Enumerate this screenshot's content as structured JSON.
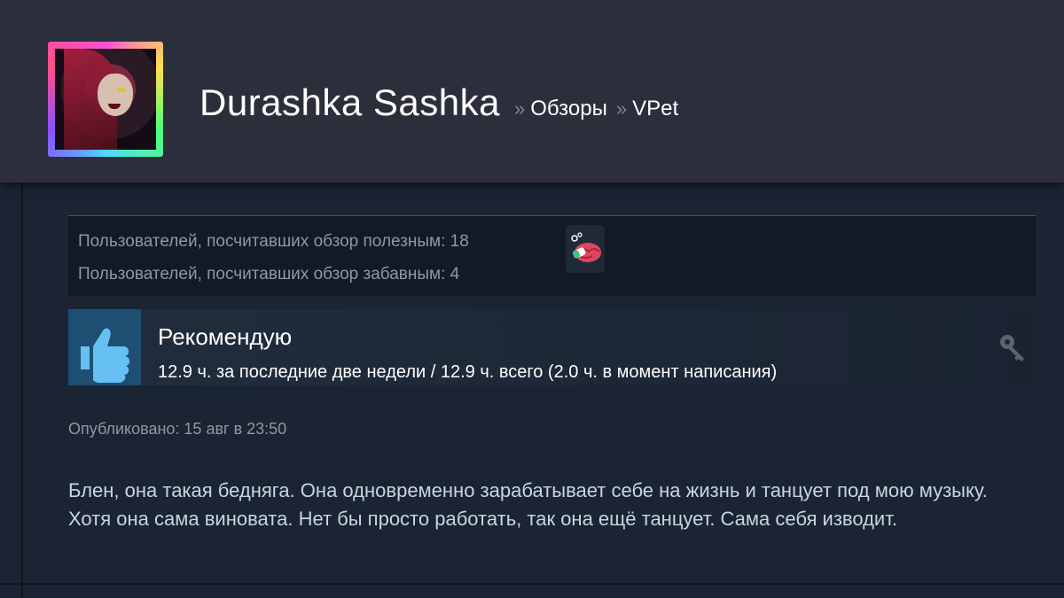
{
  "header": {
    "username": "Durashka Sashka",
    "separator": "»",
    "breadcrumbs": [
      "Обзоры",
      "VPet"
    ]
  },
  "votes": {
    "helpful": "Пользователей, посчитавших обзор полезным: 18",
    "funny": "Пользователей, посчитавших обзор забавным: 4",
    "award_icon": "brain-award-icon"
  },
  "recommendation": {
    "title": "Рекомендую",
    "hours": "12.9 ч. за последние две недели / 12.9 ч. всего (2.0 ч. в момент написания)",
    "thumb_icon": "thumbs-up-icon",
    "key_icon": "key-icon"
  },
  "posted": "Опубликовано: 15 авг в 23:50",
  "review_text": "Блен, она такая бедняга. Она одновременно зарабатывает себе на жизнь и танцует под мою музыку. Хотя она сама виновата. Нет бы просто работать, так она ещё танцует. Сама себя изводит.",
  "colors": {
    "header_bg": "#2c2f3b",
    "page_bg": "#1b2433",
    "thumb_bg": "#1e4f72",
    "thumb_icon": "#66c0f4",
    "muted_text": "#8f98a0",
    "body_text": "#c7d5e0"
  }
}
